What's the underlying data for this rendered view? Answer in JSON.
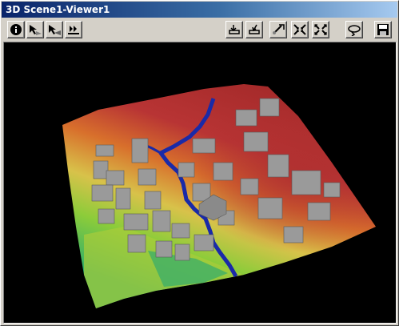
{
  "window": {
    "title": "3D Scene1-Viewer1"
  },
  "toolbar": {
    "left_buttons": [
      {
        "name": "identify-button",
        "icon": "info-icon"
      },
      {
        "name": "navigate-button",
        "icon": "navigate-icon"
      },
      {
        "name": "fly-button",
        "icon": "fly-icon"
      },
      {
        "name": "zoom-in-out-button",
        "icon": "zoom-in-out-icon"
      }
    ],
    "right_buttons": [
      {
        "name": "center-on-target-button",
        "icon": "center-target-icon"
      },
      {
        "name": "zoom-to-target-button",
        "icon": "zoom-target-icon"
      },
      {
        "name": "set-observer-button",
        "icon": "observer-icon"
      },
      {
        "name": "narrow-field-of-view-button",
        "icon": "narrow-view-icon"
      },
      {
        "name": "full-extent-button",
        "icon": "full-extent-icon"
      },
      {
        "name": "toggle-animation-button",
        "icon": "rotate-icon"
      },
      {
        "name": "save-button",
        "icon": "floppy-disk-icon"
      }
    ]
  },
  "viewport": {
    "content": "3d-terrain-scene",
    "background": "#000000",
    "colors": {
      "high_elevation": "#b52c2c",
      "mid_high": "#d86a2a",
      "mid": "#d8c24a",
      "low": "#8ccc3a",
      "lowest": "#2fae6a",
      "river": "#1a2aa8",
      "buildings": "#9a9a9a"
    }
  }
}
